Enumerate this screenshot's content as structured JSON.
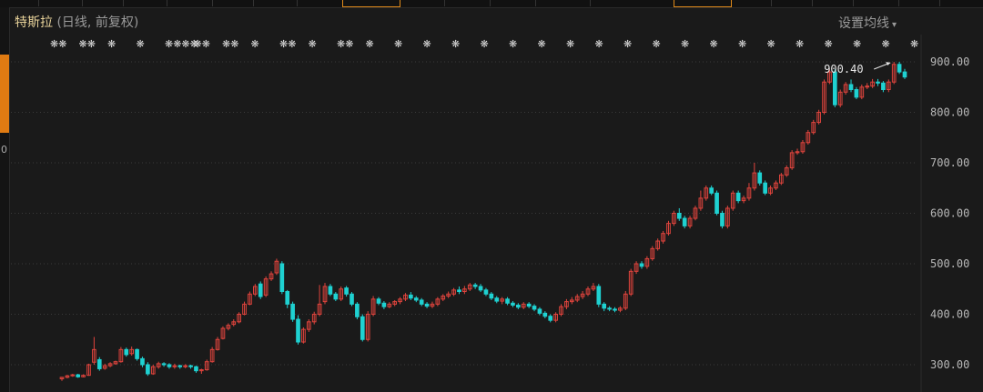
{
  "window": {
    "title": "特斯拉",
    "subtitle": "(日线, 前复权)",
    "settings_label": "设置均线",
    "left_mark": "0"
  },
  "colors": {
    "background": "#1a1a1a",
    "grid": "#3a3a3a",
    "up": "#e0443d",
    "down": "#1fd1d1",
    "axis_text": "#b8b8b8",
    "title_text": "#e8d39a",
    "accent": "#e07b12"
  },
  "chart_data": {
    "type": "candlestick",
    "title": "特斯拉",
    "y_ticks": [
      "900.00",
      "800.00",
      "700.00",
      "600.00",
      "500.00",
      "400.00",
      "300.00"
    ],
    "y_tick_values": [
      900,
      800,
      700,
      600,
      500,
      400,
      300
    ],
    "ylim": [
      264,
      923
    ],
    "max_marker": "900.40",
    "event_markers": [
      "❋❋",
      "❋❋",
      "❋",
      "❋",
      "❋❋❋❋",
      "❋❋",
      "❋❋",
      "❋",
      "❋❋",
      "❋",
      "❋❋",
      "❋",
      "❋",
      "❋",
      "❋",
      "❋",
      "❋",
      "❋",
      "❋",
      "❋",
      "❋",
      "❋",
      "❋",
      "❋",
      "❋",
      "❋",
      "❋",
      "❋",
      "❋",
      "❋",
      "❋"
    ],
    "candles": [
      [
        272,
        275,
        268,
        276
      ],
      [
        275,
        278,
        273,
        280
      ],
      [
        278,
        280,
        276,
        282
      ],
      [
        280,
        276,
        274,
        282
      ],
      [
        276,
        279,
        275,
        281
      ],
      [
        279,
        300,
        278,
        302
      ],
      [
        305,
        330,
        300,
        355
      ],
      [
        310,
        292,
        288,
        315
      ],
      [
        293,
        298,
        290,
        302
      ],
      [
        298,
        302,
        295,
        305
      ],
      [
        302,
        306,
        300,
        308
      ],
      [
        306,
        330,
        304,
        335
      ],
      [
        330,
        320,
        316,
        334
      ],
      [
        322,
        330,
        318,
        336
      ],
      [
        330,
        312,
        308,
        332
      ],
      [
        312,
        300,
        295,
        316
      ],
      [
        300,
        282,
        278,
        305
      ],
      [
        282,
        296,
        280,
        300
      ],
      [
        296,
        302,
        292,
        306
      ],
      [
        302,
        300,
        296,
        305
      ],
      [
        300,
        296,
        292,
        303
      ],
      [
        296,
        298,
        292,
        302
      ],
      [
        298,
        296,
        292,
        300
      ],
      [
        296,
        298,
        293,
        301
      ],
      [
        298,
        296,
        292,
        300
      ],
      [
        296,
        288,
        284,
        298
      ],
      [
        288,
        290,
        282,
        292
      ],
      [
        290,
        306,
        288,
        310
      ],
      [
        306,
        330,
        304,
        335
      ],
      [
        330,
        350,
        328,
        355
      ],
      [
        352,
        372,
        350,
        376
      ],
      [
        372,
        378,
        368,
        382
      ],
      [
        380,
        385,
        376,
        390
      ],
      [
        385,
        400,
        382,
        404
      ],
      [
        400,
        420,
        398,
        425
      ],
      [
        420,
        440,
        418,
        445
      ],
      [
        440,
        455,
        436,
        460
      ],
      [
        460,
        435,
        430,
        465
      ],
      [
        438,
        470,
        434,
        475
      ],
      [
        470,
        480,
        466,
        485
      ],
      [
        482,
        505,
        478,
        510
      ],
      [
        500,
        445,
        440,
        505
      ],
      [
        445,
        420,
        412,
        448
      ],
      [
        420,
        390,
        385,
        425
      ],
      [
        390,
        345,
        340,
        398
      ],
      [
        345,
        370,
        342,
        374
      ],
      [
        370,
        385,
        365,
        390
      ],
      [
        385,
        400,
        380,
        405
      ],
      [
        400,
        420,
        396,
        458
      ],
      [
        425,
        455,
        420,
        462
      ],
      [
        455,
        440,
        436,
        460
      ],
      [
        440,
        430,
        426,
        444
      ],
      [
        430,
        450,
        426,
        455
      ],
      [
        452,
        440,
        435,
        456
      ],
      [
        440,
        420,
        416,
        444
      ],
      [
        420,
        395,
        390,
        424
      ],
      [
        395,
        350,
        346,
        400
      ],
      [
        350,
        400,
        346,
        406
      ],
      [
        400,
        430,
        396,
        436
      ],
      [
        430,
        422,
        418,
        434
      ],
      [
        422,
        415,
        410,
        426
      ],
      [
        415,
        420,
        412,
        424
      ],
      [
        420,
        425,
        416,
        428
      ],
      [
        425,
        430,
        420,
        434
      ],
      [
        430,
        438,
        426,
        442
      ],
      [
        438,
        432,
        428,
        444
      ],
      [
        432,
        428,
        424,
        436
      ],
      [
        428,
        420,
        416,
        432
      ],
      [
        420,
        416,
        412,
        424
      ],
      [
        416,
        420,
        412,
        425
      ],
      [
        420,
        430,
        416,
        434
      ],
      [
        430,
        436,
        426,
        440
      ],
      [
        436,
        440,
        432,
        445
      ],
      [
        440,
        448,
        436,
        452
      ],
      [
        448,
        445,
        440,
        455
      ],
      [
        445,
        450,
        440,
        456
      ],
      [
        450,
        458,
        446,
        462
      ],
      [
        458,
        455,
        450,
        462
      ],
      [
        455,
        448,
        444,
        460
      ],
      [
        448,
        440,
        436,
        452
      ],
      [
        440,
        432,
        428,
        444
      ],
      [
        432,
        426,
        422,
        436
      ],
      [
        426,
        430,
        420,
        434
      ],
      [
        430,
        422,
        418,
        434
      ],
      [
        422,
        418,
        414,
        426
      ],
      [
        418,
        414,
        410,
        422
      ],
      [
        414,
        420,
        410,
        424
      ],
      [
        420,
        416,
        412,
        424
      ],
      [
        416,
        410,
        406,
        420
      ],
      [
        410,
        402,
        398,
        414
      ],
      [
        402,
        396,
        392,
        406
      ],
      [
        396,
        388,
        384,
        400
      ],
      [
        388,
        400,
        384,
        404
      ],
      [
        400,
        415,
        396,
        420
      ],
      [
        415,
        425,
        410,
        430
      ],
      [
        425,
        428,
        420,
        434
      ],
      [
        428,
        435,
        424,
        440
      ],
      [
        435,
        440,
        430,
        446
      ],
      [
        440,
        450,
        436,
        455
      ],
      [
        450,
        455,
        446,
        462
      ],
      [
        455,
        420,
        414,
        460
      ],
      [
        420,
        412,
        406,
        424
      ],
      [
        412,
        410,
        406,
        416
      ],
      [
        410,
        408,
        404,
        414
      ],
      [
        408,
        412,
        404,
        416
      ],
      [
        412,
        440,
        408,
        446
      ],
      [
        440,
        485,
        436,
        490
      ],
      [
        485,
        500,
        480,
        505
      ],
      [
        500,
        495,
        490,
        505
      ],
      [
        495,
        510,
        490,
        515
      ],
      [
        510,
        530,
        506,
        535
      ],
      [
        530,
        545,
        526,
        550
      ],
      [
        545,
        560,
        540,
        565
      ],
      [
        560,
        580,
        556,
        585
      ],
      [
        580,
        600,
        575,
        605
      ],
      [
        600,
        590,
        585,
        610
      ],
      [
        590,
        575,
        570,
        595
      ],
      [
        575,
        590,
        570,
        595
      ],
      [
        590,
        610,
        586,
        615
      ],
      [
        610,
        630,
        605,
        645
      ],
      [
        630,
        650,
        625,
        655
      ],
      [
        650,
        640,
        636,
        655
      ],
      [
        640,
        600,
        596,
        645
      ],
      [
        600,
        575,
        570,
        605
      ],
      [
        575,
        610,
        570,
        615
      ],
      [
        610,
        640,
        605,
        645
      ],
      [
        640,
        625,
        620,
        645
      ],
      [
        625,
        630,
        620,
        635
      ],
      [
        630,
        650,
        625,
        660
      ],
      [
        650,
        680,
        645,
        700
      ],
      [
        680,
        660,
        655,
        685
      ],
      [
        660,
        640,
        636,
        665
      ],
      [
        640,
        650,
        636,
        655
      ],
      [
        650,
        660,
        646,
        665
      ],
      [
        660,
        676,
        656,
        680
      ],
      [
        676,
        690,
        672,
        695
      ],
      [
        690,
        720,
        686,
        725
      ],
      [
        720,
        722,
        716,
        728
      ],
      [
        722,
        740,
        718,
        745
      ],
      [
        740,
        760,
        736,
        765
      ],
      [
        760,
        780,
        756,
        785
      ],
      [
        780,
        800,
        776,
        805
      ],
      [
        800,
        860,
        796,
        865
      ],
      [
        860,
        880,
        856,
        885
      ],
      [
        880,
        815,
        810,
        885
      ],
      [
        815,
        840,
        810,
        845
      ],
      [
        840,
        855,
        835,
        860
      ],
      [
        855,
        845,
        840,
        865
      ],
      [
        845,
        830,
        826,
        850
      ],
      [
        830,
        850,
        826,
        855
      ],
      [
        850,
        852,
        846,
        858
      ],
      [
        852,
        860,
        848,
        866
      ],
      [
        860,
        858,
        852,
        866
      ],
      [
        858,
        845,
        840,
        862
      ],
      [
        845,
        860,
        840,
        865
      ],
      [
        860,
        895,
        856,
        900
      ],
      [
        895,
        880,
        876,
        900
      ],
      [
        880,
        870,
        866,
        886
      ]
    ]
  },
  "topbar": {
    "tabs": [
      {
        "x": 0,
        "w": 42
      },
      {
        "x": 42,
        "w": 48
      },
      {
        "x": 90,
        "w": 45
      },
      {
        "x": 135,
        "w": 48
      },
      {
        "x": 183,
        "w": 50
      },
      {
        "x": 233,
        "w": 45
      },
      {
        "x": 278,
        "w": 48
      },
      {
        "x": 326,
        "w": 50
      },
      {
        "x": 376,
        "w": 62,
        "active": true
      },
      {
        "x": 438,
        "w": 50
      },
      {
        "x": 488,
        "w": 50
      },
      {
        "x": 538,
        "w": 50
      },
      {
        "x": 588,
        "w": 60
      },
      {
        "x": 685,
        "w": 55
      },
      {
        "x": 740,
        "w": 62,
        "active": true
      },
      {
        "x": 802,
        "w": 45
      },
      {
        "x": 847,
        "w": 45
      },
      {
        "x": 892,
        "w": 45
      },
      {
        "x": 937,
        "w": 50
      },
      {
        "x": 987,
        "w": 45
      }
    ]
  }
}
